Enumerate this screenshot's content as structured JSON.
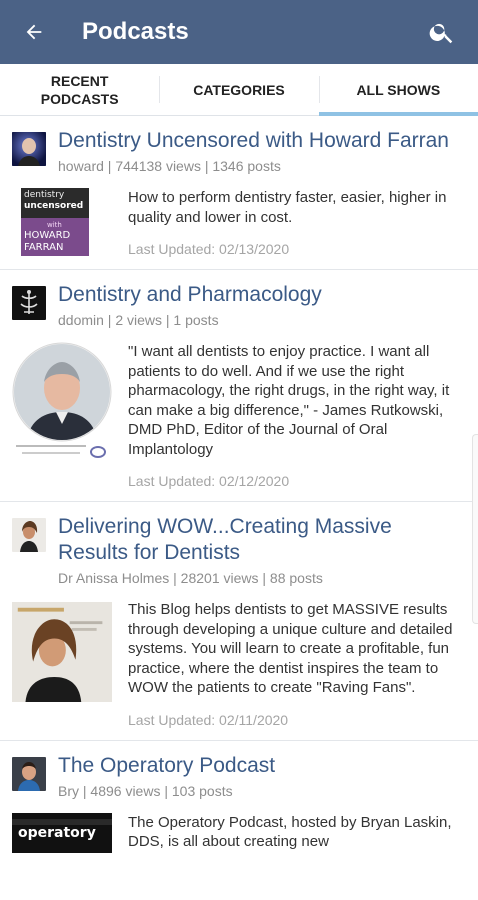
{
  "app": {
    "title": "Podcasts"
  },
  "tabs": [
    {
      "label": "Recent\nPodcasts",
      "line1": "RECENT",
      "line2": "PODCASTS"
    },
    {
      "label": "Categories"
    },
    {
      "label": "All Shows"
    }
  ],
  "shows": [
    {
      "title": "Dentistry Uncensored with Howard Farran",
      "meta": "howard | 744138 views | 1346 posts",
      "description": "How to perform dentistry faster, easier, higher in quality and lower in cost.",
      "updated": "Last Updated: 02/13/2020",
      "art_text": {
        "a": "dentistry",
        "b": "uncensored",
        "c": "with",
        "d": "HOWARD",
        "e": "FARRAN"
      }
    },
    {
      "title": "Dentistry and Pharmacology",
      "meta": "ddomin | 2 views | 1 posts",
      "description": "\"I want all dentists to enjoy practice. I want all patients to do well. And if we use the right pharmacology, the right drugs, in the right way, it can make a big difference,\" - James Rutkowski, DMD PhD, Editor of the Journal of Oral Implantology",
      "updated": "Last Updated: 02/12/2020"
    },
    {
      "title": "Delivering WOW...Creating Massive Results for Dentists",
      "meta": "Dr Anissa Holmes | 28201 views | 88 posts",
      "description": "This Blog helps dentists to get MASSIVE results through developing a unique culture and detailed systems. You will learn to create a profitable, fun practice, where the dentist inspires the team to WOW the patients to create \"Raving Fans\".",
      "updated": "Last Updated: 02/11/2020"
    },
    {
      "title": "The Operatory Podcast",
      "meta": "Bry | 4896 views | 103 posts",
      "description": "The Operatory Podcast, hosted by Bryan Laskin, DDS, is all about creating new",
      "art_text": {
        "a": "operatory"
      }
    }
  ],
  "colors": {
    "appbar": "#4b6286",
    "title_link": "#3b5a86",
    "tab_indicator": "#8fc2e4"
  },
  "icons": {
    "back": "arrow-left-icon",
    "search": "search-icon"
  }
}
